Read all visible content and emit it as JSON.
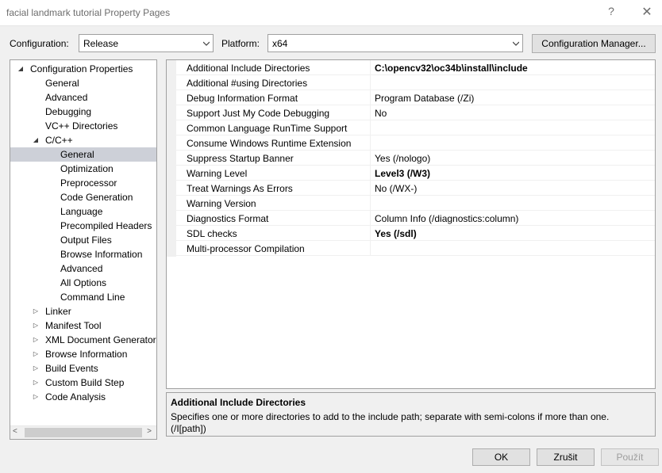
{
  "window": {
    "title": "facial landmark tutorial Property Pages",
    "help_glyph": "?",
    "close_glyph": "✕"
  },
  "toolbar": {
    "configuration_label": "Configuration:",
    "configuration_value": "Release",
    "platform_label": "Platform:",
    "platform_value": "x64",
    "config_manager_label": "Configuration Manager..."
  },
  "tree": {
    "items": [
      {
        "label": "Configuration Properties",
        "expander": "◢"
      },
      {
        "label": "General"
      },
      {
        "label": "Advanced"
      },
      {
        "label": "Debugging"
      },
      {
        "label": "VC++ Directories"
      },
      {
        "label": "C/C++",
        "expander": "◢"
      },
      {
        "label": "General"
      },
      {
        "label": "Optimization"
      },
      {
        "label": "Preprocessor"
      },
      {
        "label": "Code Generation"
      },
      {
        "label": "Language"
      },
      {
        "label": "Precompiled Headers"
      },
      {
        "label": "Output Files"
      },
      {
        "label": "Browse Information"
      },
      {
        "label": "Advanced"
      },
      {
        "label": "All Options"
      },
      {
        "label": "Command Line"
      },
      {
        "label": "Linker",
        "expander": "▷"
      },
      {
        "label": "Manifest Tool",
        "expander": "▷"
      },
      {
        "label": "XML Document Generator",
        "expander": "▷"
      },
      {
        "label": "Browse Information",
        "expander": "▷"
      },
      {
        "label": "Build Events",
        "expander": "▷"
      },
      {
        "label": "Custom Build Step",
        "expander": "▷"
      },
      {
        "label": "Code Analysis",
        "expander": "▷"
      }
    ],
    "scroll_left": "<",
    "scroll_right": ">"
  },
  "grid": {
    "rows": [
      {
        "name": "Additional Include Directories",
        "value": "C:\\opencv32\\oc34b\\install\\include",
        "bold": true
      },
      {
        "name": "Additional #using Directories",
        "value": ""
      },
      {
        "name": "Debug Information Format",
        "value": "Program Database (/Zi)"
      },
      {
        "name": "Support Just My Code Debugging",
        "value": "No"
      },
      {
        "name": "Common Language RunTime Support",
        "value": ""
      },
      {
        "name": "Consume Windows Runtime Extension",
        "value": ""
      },
      {
        "name": "Suppress Startup Banner",
        "value": "Yes (/nologo)"
      },
      {
        "name": "Warning Level",
        "value": "Level3 (/W3)",
        "bold": true
      },
      {
        "name": "Treat Warnings As Errors",
        "value": "No (/WX-)"
      },
      {
        "name": "Warning Version",
        "value": ""
      },
      {
        "name": "Diagnostics Format",
        "value": "Column Info (/diagnostics:column)"
      },
      {
        "name": "SDL checks",
        "value": "Yes (/sdl)",
        "bold": true
      },
      {
        "name": "Multi-processor Compilation",
        "value": ""
      }
    ]
  },
  "description": {
    "title": "Additional Include Directories",
    "text": "Specifies one or more directories to add to the include path; separate with semi-colons if more than one. (/I[path])"
  },
  "buttons": {
    "ok": "OK",
    "cancel": "Zrušit",
    "apply": "Použít"
  }
}
